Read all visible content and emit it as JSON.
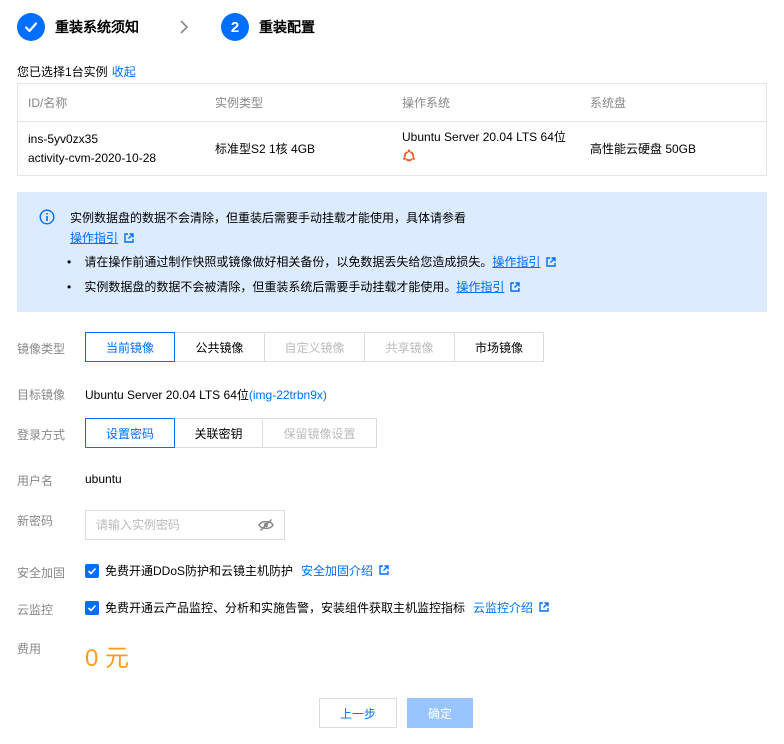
{
  "steps": [
    {
      "label": "重装系统须知",
      "state": "done"
    },
    {
      "number": "2",
      "label": "重装配置",
      "state": "current"
    }
  ],
  "selected": {
    "text": "您已选择1台实例",
    "collapse_link": "收起"
  },
  "table": {
    "headers": [
      "ID/名称",
      "实例类型",
      "操作系统",
      "系统盘"
    ],
    "row": {
      "id": "ins-5yv0zx35",
      "name": "activity-cvm-2020-10-28",
      "type": "标准型S2 1核 4GB",
      "os": "Ubuntu Server 20.04 LTS 64位",
      "disk": "高性能云硬盘 50GB"
    }
  },
  "notice": {
    "main": "实例数据盘的数据不会清除，但重装后需要手动挂载才能使用，具体请参看",
    "main_link": "操作指引",
    "bullets": [
      {
        "text": "请在操作前通过制作快照或镜像做好相关备份，以免数据丢失给您造成损失。",
        "link": "操作指引"
      },
      {
        "text": "实例数据盘的数据不会被清除，但重装系统后需要手动挂载才能使用。",
        "link": "操作指引"
      }
    ]
  },
  "form": {
    "image_type": {
      "label": "镜像类型",
      "options": [
        {
          "label": "当前镜像",
          "state": "active"
        },
        {
          "label": "公共镜像",
          "state": "normal"
        },
        {
          "label": "自定义镜像",
          "state": "disabled"
        },
        {
          "label": "共享镜像",
          "state": "disabled"
        },
        {
          "label": "市场镜像",
          "state": "normal"
        }
      ]
    },
    "target_image": {
      "label": "目标镜像",
      "value": "Ubuntu Server 20.04 LTS 64位",
      "image_id": "(img-22trbn9x)"
    },
    "login": {
      "label": "登录方式",
      "options": [
        {
          "label": "设置密码",
          "state": "active"
        },
        {
          "label": "关联密钥",
          "state": "normal"
        },
        {
          "label": "保留镜像设置",
          "state": "disabled"
        }
      ]
    },
    "username": {
      "label": "用户名",
      "value": "ubuntu"
    },
    "new_password": {
      "label": "新密码",
      "placeholder": "请输入实例密码",
      "value": ""
    },
    "security": {
      "label": "安全加固",
      "text": "免费开通DDoS防护和云镜主机防护",
      "link": "安全加固介绍",
      "checked": true
    },
    "monitor": {
      "label": "云监控",
      "text": "免费开通云产品监控、分析和实施告警，安装组件获取主机监控指标",
      "link": "云监控介绍",
      "checked": true
    },
    "fee": {
      "label": "费用",
      "value": "0 元"
    }
  },
  "buttons": {
    "prev": "上一步",
    "confirm": "确定"
  },
  "colors": {
    "primary": "#006eff",
    "notice_bg": "#dcebfd",
    "fee": "#ff9c19",
    "ubuntu": "#e95420"
  },
  "icons": [
    "check-icon",
    "chevron-right-icon",
    "ubuntu-logo-icon",
    "info-icon",
    "external-link-icon",
    "eye-off-icon",
    "checkbox-checked-icon"
  ]
}
